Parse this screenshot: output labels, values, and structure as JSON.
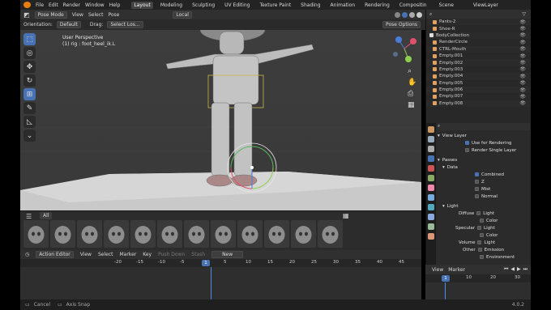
{
  "menu": {
    "items": [
      "File",
      "Edit",
      "Render",
      "Window",
      "Help"
    ],
    "workspaces": [
      "Layout",
      "Modeling",
      "Sculpting",
      "UV Editing",
      "Texture Paint",
      "Shading",
      "Animation",
      "Rendering",
      "Compositin"
    ],
    "active_workspace": "Layout",
    "scene": "Scene",
    "view_layer": "ViewLayer"
  },
  "viewport_header": {
    "mode": "Pose Mode",
    "menus": [
      "View",
      "Select",
      "Pose"
    ],
    "transform_orientation": "Local",
    "orientation_label": "Orientation:",
    "orientation_value": "Default",
    "drag_label": "Drag:",
    "drag_value": "Select Los...",
    "pose_options": "Pose Options"
  },
  "viewport": {
    "view_name": "User Perspective",
    "active_object": "(1) rig : foot_heel_ik.L"
  },
  "outliner": {
    "rows": [
      {
        "label": "Pants-2"
      },
      {
        "label": "Shoe-R"
      },
      {
        "label": "BodyCollection"
      },
      {
        "label": "RenderCircle"
      },
      {
        "label": "CTRL-Mouth"
      },
      {
        "label": "Empty.001"
      },
      {
        "label": "Empty.002"
      },
      {
        "label": "Empty.003"
      },
      {
        "label": "Empty.004"
      },
      {
        "label": "Empty.005"
      },
      {
        "label": "Empty.006"
      },
      {
        "label": "Empty.007"
      },
      {
        "label": "Empty.008"
      }
    ]
  },
  "properties": {
    "view_layer_section": "View Layer",
    "use_for_rendering": "Use for Rendering",
    "render_single_layer": "Render Single Layer",
    "passes": "Passes",
    "data": "Data",
    "combined": "Combined",
    "z": "Z",
    "mist": "Mist",
    "normal": "Normal",
    "light": "Light",
    "diffuse": "Diffuse",
    "specular": "Specular",
    "volume": "Volume",
    "other": "Other",
    "light_label": "Light",
    "color_label": "Color",
    "emission": "Emission",
    "environment": "Environment"
  },
  "asset_shelf": {
    "tab": "All"
  },
  "timeline": {
    "editor": "Action Editor",
    "menus": [
      "View",
      "Select",
      "Marker",
      "Key"
    ],
    "push_down": "Push Down",
    "stash": "Stash",
    "new_button": "New",
    "ruler": [
      "-20",
      "-15",
      "-10",
      "-5",
      "1",
      "5",
      "10",
      "15",
      "20",
      "25",
      "30",
      "35",
      "40",
      "45"
    ],
    "current_frame": "1"
  },
  "mini_timeline": {
    "menus": [
      "View",
      "Marker"
    ],
    "ruler": [
      "1",
      "10",
      "20",
      "30"
    ],
    "current_frame": "1"
  },
  "status": {
    "cancel": "Cancel",
    "axis_snap": "Axis Snap",
    "version": "4.0.2"
  },
  "colors": {
    "accent": "#4772b3",
    "orange": "#e87d0d"
  }
}
